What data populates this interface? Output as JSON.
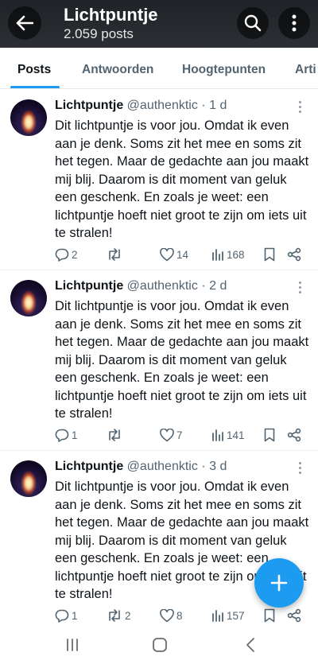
{
  "header": {
    "title": "Lichtpuntje",
    "subtitle": "2.059 posts"
  },
  "tabs": [
    {
      "label": "Posts",
      "active": true
    },
    {
      "label": "Antwoorden",
      "active": false
    },
    {
      "label": "Hoogtepunten",
      "active": false
    },
    {
      "label": "Arti",
      "active": false
    }
  ],
  "posts": [
    {
      "name": "Lichtpuntje",
      "handle": "@authenktic",
      "separator": "·",
      "time": "1 d",
      "text": "Dit lichtpuntje is voor jou. Omdat ik even aan je denk. Soms zit het mee en soms zit het tegen. Maar de gedachte aan jou maakt mij blij. Daarom is dit moment van geluk een geschenk. En zoals je weet: een lichtpuntje hoeft niet groot te zijn om iets uit te stralen!",
      "replies": "2",
      "reposts": "",
      "likes": "14",
      "views": "168"
    },
    {
      "name": "Lichtpuntje",
      "handle": "@authenktic",
      "separator": "·",
      "time": "2 d",
      "text": "Dit lichtpuntje is voor jou. Omdat ik even aan je denk. Soms zit het mee en soms zit het tegen. Maar de gedachte aan jou maakt mij blij. Daarom is dit moment van geluk een geschenk. En zoals je weet: een lichtpuntje hoeft niet groot te zijn om iets uit te stralen!",
      "replies": "1",
      "reposts": "",
      "likes": "7",
      "views": "141"
    },
    {
      "name": "Lichtpuntje",
      "handle": "@authenktic",
      "separator": "·",
      "time": "3 d",
      "text": "Dit lichtpuntje is voor jou. Omdat ik even aan je denk. Soms zit het mee en soms zit het tegen. Maar de gedachte aan jou maakt mij blij. Daarom is dit moment van geluk een geschenk. En zoals je weet: een lichtpuntje hoeft niet groot te zijn om iets uit te stralen!",
      "replies": "1",
      "reposts": "2",
      "likes": "8",
      "views": "157"
    }
  ],
  "icons": {
    "back": "arrow-left-icon",
    "search": "search-icon",
    "more": "more-vertical-icon",
    "reply": "reply-icon",
    "repost": "repost-icon",
    "like": "heart-icon",
    "views": "views-icon",
    "bookmark": "bookmark-icon",
    "share": "share-icon",
    "compose": "plus-icon"
  },
  "colors": {
    "accent": "#1d9bf0",
    "text_primary": "#0f1419",
    "text_secondary": "#536471",
    "header_bg": "#2c2f33"
  }
}
